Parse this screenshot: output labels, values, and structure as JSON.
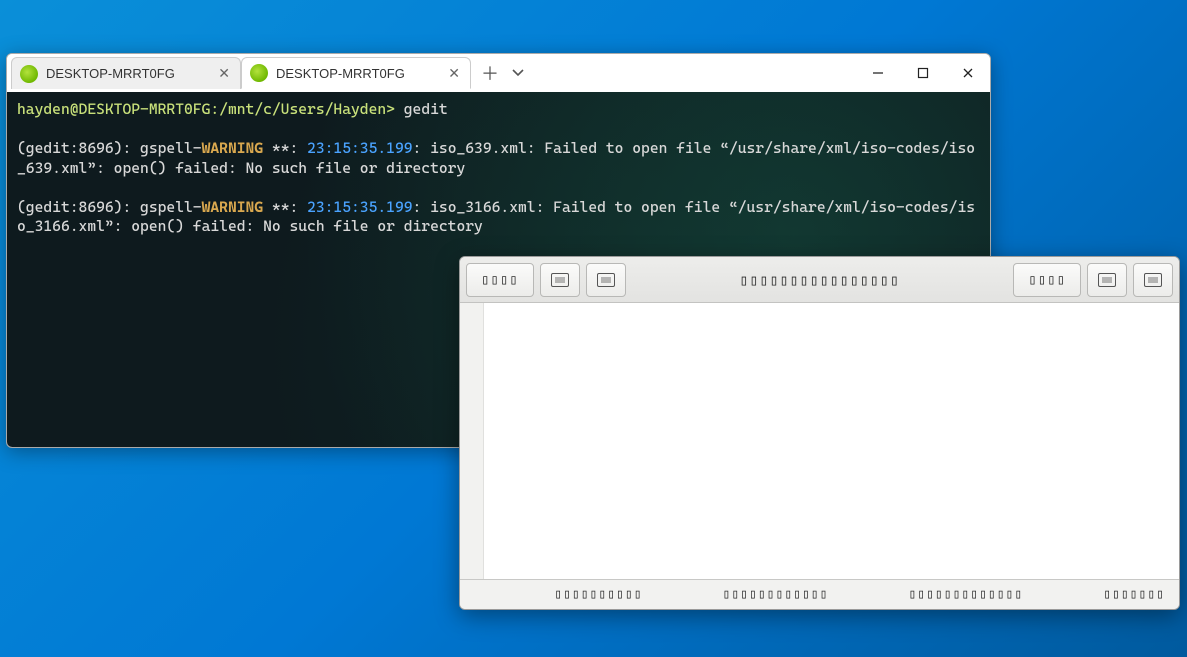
{
  "terminal": {
    "tabs": [
      {
        "label": "DESKTOP-MRRT0FG"
      },
      {
        "label": "DESKTOP-MRRT0FG"
      }
    ],
    "prompt": "hayden@DESKTOP-MRRT0FG:/mnt/c/Users/Hayden>",
    "command": "gedit",
    "warn1_prefix": "(gedit:8696): gspell-",
    "warn_label": "WARNING",
    "warn_stars": " **: ",
    "timestamp": "23:15:35.199",
    "warn1_after": ": iso_639.xml: Failed to open file “/usr/share/xml/iso-codes/iso_639.xml”: open() failed: No such file or directory",
    "warn2_prefix": "(gedit:8696): gspell-",
    "warn2_after": ": iso_3166.xml: Failed to open file “/usr/share/xml/iso-codes/iso_3166.xml”: open() failed: No such file or directory"
  },
  "gedit": {
    "open_label": "󠀠󠀠󠀠󠀠",
    "save_label": "󠀠󠀠󠀠󠀠",
    "title": "󠀠󠀠󠀠󠀠󠀠󠀠󠀠󠀠󠀠󠀠󠀠󠀠󠀠󠀠󠀠󠀠",
    "status": {
      "item1": "󠀠󠀠󠀠󠀠󠀠󠀠󠀠󠀠󠀠󠀠",
      "item2": "󠀠󠀠󠀠󠀠󠀠󠀠󠀠󠀠󠀠󠀠󠀠󠀠",
      "item3": "󠀠󠀠󠀠󠀠󠀠󠀠󠀠󠀠󠀠󠀠󠀠󠀠󠀠",
      "item4": "󠀠󠀠󠀠󠀠󠀠󠀠󠀠"
    },
    "placeholder_boxes": {
      "btn4": "▯▯▯▯",
      "title16": "▯▯▯▯▯▯▯▯▯▯▯▯▯▯▯▯",
      "s10": "▯▯▯▯▯▯▯▯▯▯",
      "s12": "▯▯▯▯▯▯▯▯▯▯▯▯",
      "s13": "▯▯▯▯▯▯▯▯▯▯▯▯▯",
      "s7": "▯▯▯▯▯▯▯"
    }
  }
}
